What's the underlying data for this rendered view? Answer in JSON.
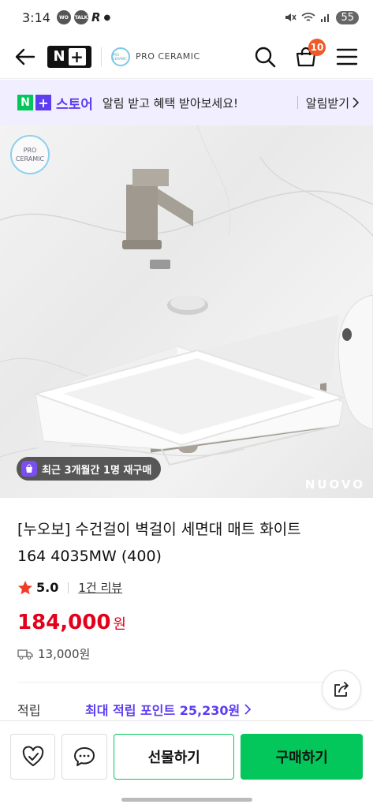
{
  "status_bar": {
    "time": "3:14",
    "badge_1": "WO",
    "badge_2": "TALK",
    "badge_3": "R",
    "battery": "55"
  },
  "header": {
    "logo_n": "N",
    "logo_plus": "+",
    "store_logo_text": "PRO CERAMIC",
    "store_name": "PRO CERAMIC",
    "cart_count": "10"
  },
  "promo": {
    "logo_n": "N",
    "logo_plus": "+",
    "logo_store": "스토어",
    "text": "알림 받고 혜택 받아보세요!",
    "action": "알림받기"
  },
  "image": {
    "watermark_line1": "PRO",
    "watermark_line2": "CERAMIC",
    "repurchase": "최근 3개월간 1명 재구매",
    "brand": "NUOVO"
  },
  "product": {
    "title_line1": "[누오보] 수건걸이 벽걸이 세면대 매트 화이트",
    "title_line2": "164 4035MW (400)",
    "rating": "5.0",
    "reviews": "1건 리뷰",
    "price": "184,000",
    "currency": "원",
    "shipping": "13,000원",
    "points_label": "적립",
    "points_value": "최대 적립 포인트 25,230원"
  },
  "bottom_bar": {
    "gift": "선물하기",
    "buy": "구매하기"
  },
  "colors": {
    "naver_green": "#03c75a",
    "naver_purple": "#5d3df0",
    "price_red": "#e3001b",
    "cart_badge": "#f05a28"
  }
}
